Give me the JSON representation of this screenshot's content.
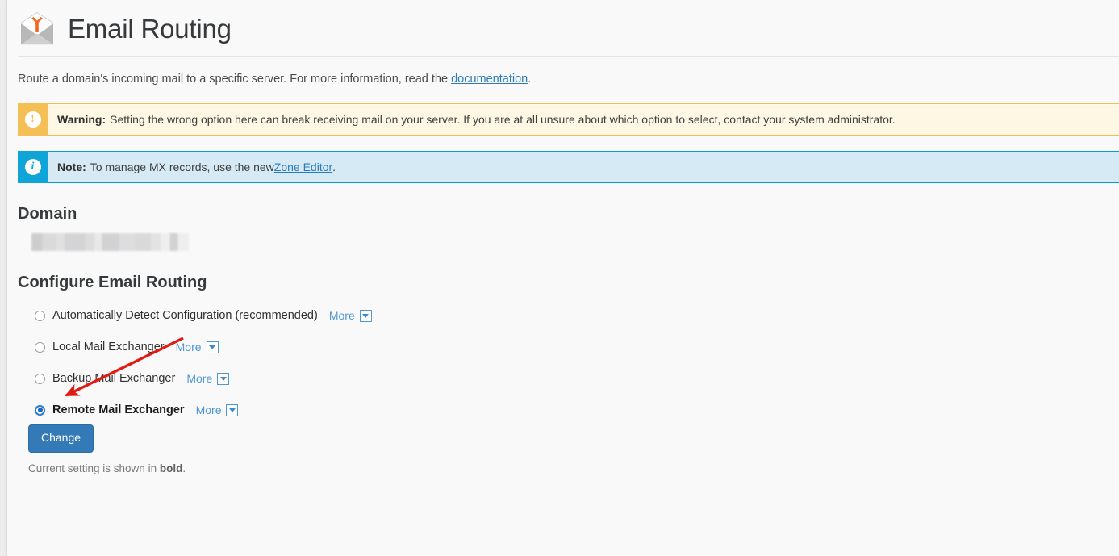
{
  "header": {
    "title": "Email Routing",
    "icon": "email-routing-envelope-icon"
  },
  "intro": {
    "text_before": "Route a domain's incoming mail to a specific server. For more information, read the ",
    "link_label": "documentation",
    "text_after": "."
  },
  "alerts": [
    {
      "type": "warning",
      "icon": "exclamation-circle-icon",
      "icon_glyph": "!",
      "label": "Warning:",
      "message": "Setting the wrong option here can break receiving mail on your server. If you are at all unsure about which option to select, contact your system administrator.",
      "accent_color": "#f4bf55",
      "background_color": "#fdf7e3"
    },
    {
      "type": "info",
      "icon": "info-circle-icon",
      "icon_glyph": "i",
      "label": "Note:",
      "message_before": "To manage MX records, use the new ",
      "link_label": "Zone Editor",
      "message_after": ".",
      "accent_color": "#10a5d8",
      "background_color": "#d5eaf5"
    }
  ],
  "domain_section": {
    "title": "Domain",
    "value": "",
    "value_state": "blurred"
  },
  "routing_section": {
    "title": "Configure Email Routing",
    "more_label": "More",
    "options": [
      {
        "label": "Automatically Detect Configuration (recommended)",
        "selected": false,
        "more_label": "More"
      },
      {
        "label": "Local Mail Exchanger",
        "selected": false,
        "more_label": "More"
      },
      {
        "label": "Backup Mail Exchanger",
        "selected": false,
        "more_label": "More"
      },
      {
        "label": "Remote Mail Exchanger",
        "selected": true,
        "more_label": "More"
      }
    ],
    "submit_label": "Change",
    "footnote_before": "Current setting is shown in ",
    "footnote_bold": "bold",
    "footnote_after": "."
  },
  "annotation": {
    "type": "red-arrow",
    "color": "#e01b12",
    "points_to": "Remote Mail Exchanger"
  },
  "colors": {
    "primary_button": "#337ab7",
    "link": "#2b7bb9",
    "more_link": "#4f97d5",
    "page_background": "#f9f9f9"
  }
}
